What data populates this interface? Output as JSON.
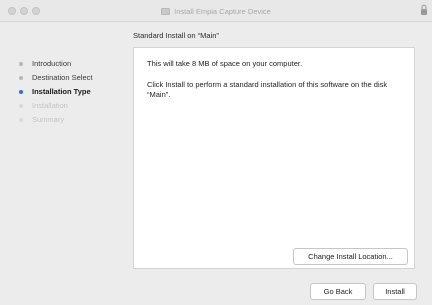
{
  "window": {
    "title": "Install Empia Capture Device"
  },
  "header": {
    "subtitle": "Standard Install on “Main”"
  },
  "sidebar": {
    "steps": [
      {
        "label": "Introduction",
        "state": "done"
      },
      {
        "label": "Destination Select",
        "state": "done"
      },
      {
        "label": "Installation Type",
        "state": "active"
      },
      {
        "label": "Installation",
        "state": "pending"
      },
      {
        "label": "Summary",
        "state": "pending"
      }
    ]
  },
  "main": {
    "line1": "This will take 8 MB of space on your computer.",
    "line2": "Click Install to perform a standard installation of this software on the disk “Main”.",
    "change_location_label": "Change Install Location..."
  },
  "footer": {
    "go_back_label": "Go Back",
    "install_label": "Install"
  },
  "colors": {
    "active_step_dot": "#2e6ee0",
    "window_bg": "#ececec",
    "panel_bg": "#ffffff"
  }
}
